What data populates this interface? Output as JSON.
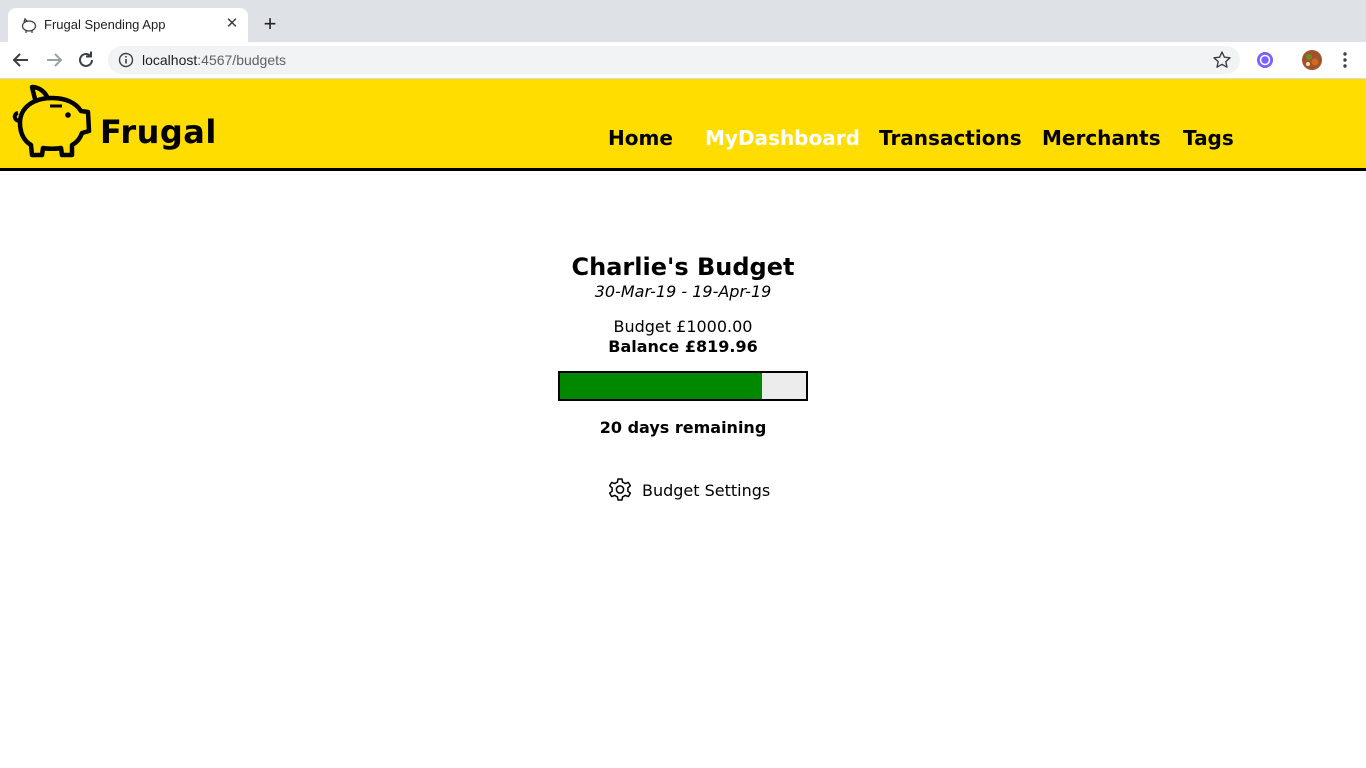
{
  "browser": {
    "tab_title": "Frugal Spending App",
    "url_host": "localhost",
    "url_path": ":4567/budgets",
    "icons": [
      "pig-favicon-icon",
      "close-icon",
      "plus-icon",
      "back-icon",
      "forward-icon",
      "reload-icon",
      "info-icon",
      "star-icon",
      "extension-icon",
      "profile-avatar",
      "kebab-menu-icon"
    ]
  },
  "header": {
    "logo_text": "Frugal",
    "logo_icon": "piggy-bank-icon",
    "nav": [
      {
        "label": "Home",
        "active": false
      },
      {
        "label": "MyDashboard",
        "active": true
      },
      {
        "label": "Transactions",
        "active": false
      },
      {
        "label": "Merchants",
        "active": false
      },
      {
        "label": "Tags",
        "active": false
      }
    ],
    "accent_color": "#ffdd00"
  },
  "budget": {
    "title": "Charlie's Budget",
    "dates": "30-Mar-19 - 19-Apr-19",
    "amount": "Budget £1000.00",
    "balance": "Balance £819.96",
    "remaining_fraction": 0.82,
    "bar_color": "#008800",
    "days_remaining": "20 days remaining",
    "settings_label": "Budget Settings",
    "settings_icon": "gear-icon"
  }
}
